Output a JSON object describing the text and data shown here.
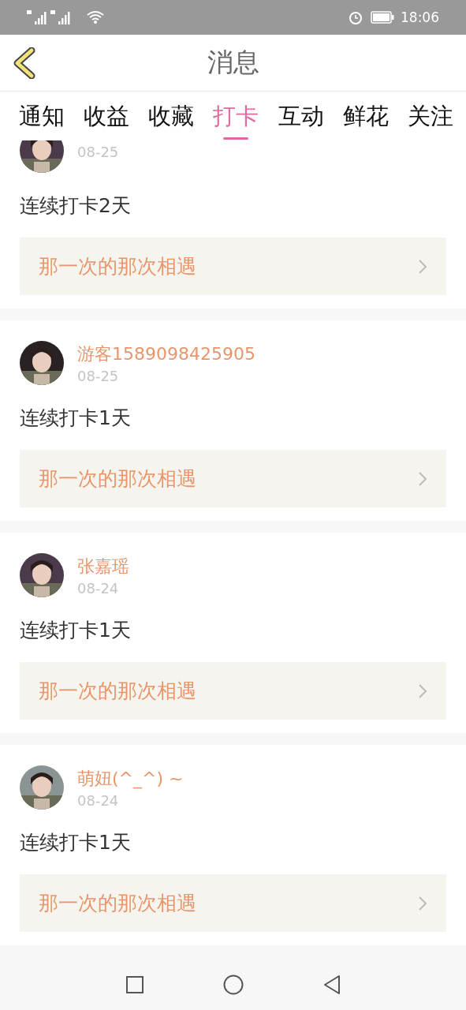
{
  "status_bar": {
    "time": "18:06"
  },
  "header": {
    "title": "消息"
  },
  "tabs": [
    {
      "label": "通知",
      "selected": false
    },
    {
      "label": "收益",
      "selected": false
    },
    {
      "label": "收藏",
      "selected": false
    },
    {
      "label": "打卡",
      "selected": true
    },
    {
      "label": "互动",
      "selected": false
    },
    {
      "label": "鲜花",
      "selected": false
    },
    {
      "label": "关注",
      "selected": false
    }
  ],
  "messages": [
    {
      "date": "08-25",
      "text": "连续打卡2天",
      "link": "那一次的那次相遇"
    },
    {
      "name": "游客1589098425905",
      "date": "08-25",
      "text": "连续打卡1天",
      "link": "那一次的那次相遇"
    },
    {
      "name": "张嘉瑶",
      "date": "08-24",
      "text": "连续打卡1天",
      "link": "那一次的那次相遇"
    },
    {
      "name": "萌妞(^_^) ~",
      "date": "08-24",
      "text": "连续打卡1天",
      "link": "那一次的那次相遇"
    }
  ]
}
